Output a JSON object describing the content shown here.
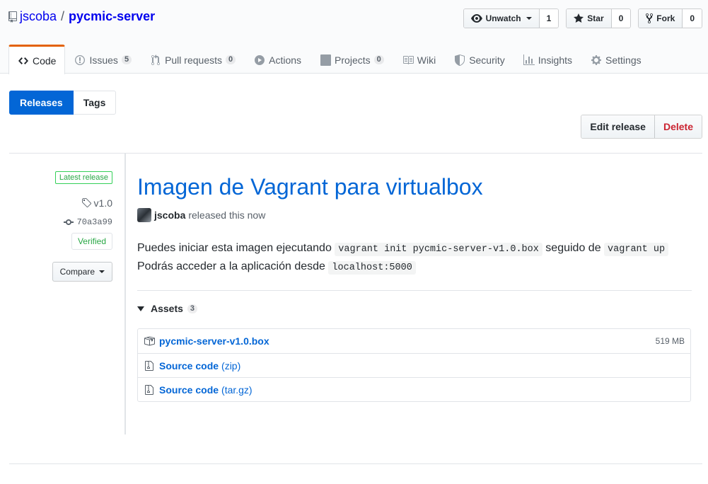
{
  "repo": {
    "owner": "jscoba",
    "separator": "/",
    "name": "pycmic-server"
  },
  "actions": {
    "watch": {
      "label": "Unwatch",
      "count": "1"
    },
    "star": {
      "label": "Star",
      "count": "0"
    },
    "fork": {
      "label": "Fork",
      "count": "0"
    }
  },
  "tabs": [
    {
      "label": "Code",
      "icon": "code-icon",
      "counter": null
    },
    {
      "label": "Issues",
      "icon": "issue-icon",
      "counter": "5"
    },
    {
      "label": "Pull requests",
      "icon": "pull-request-icon",
      "counter": "0"
    },
    {
      "label": "Actions",
      "icon": "play-icon",
      "counter": null
    },
    {
      "label": "Projects",
      "icon": "project-icon",
      "counter": "0"
    },
    {
      "label": "Wiki",
      "icon": "book-icon",
      "counter": null
    },
    {
      "label": "Security",
      "icon": "shield-icon",
      "counter": null
    },
    {
      "label": "Insights",
      "icon": "graph-icon",
      "counter": null
    },
    {
      "label": "Settings",
      "icon": "gear-icon",
      "counter": null
    }
  ],
  "subnav": {
    "releases": "Releases",
    "tags": "Tags"
  },
  "release_actions": {
    "edit": "Edit release",
    "delete": "Delete"
  },
  "meta": {
    "latest_label": "Latest release",
    "tag": "v1.0",
    "commit": "70a3a99",
    "verified": "Verified",
    "compare": "Compare"
  },
  "release": {
    "title": "Imagen de Vagrant para virtualbox",
    "author": "jscoba",
    "released_text": "released this now",
    "body": {
      "line1_prefix": "Puedes iniciar esta imagen ejecutando",
      "line1_code1": "vagrant init pycmic-server-v1.0.box",
      "line1_mid": "seguido de",
      "line1_code2": "vagrant up",
      "line2_prefix": "Podrás acceder a la aplicación desde",
      "line2_code": "localhost:5000"
    }
  },
  "assets": {
    "label": "Assets",
    "count": "3",
    "items": [
      {
        "name": "pycmic-server-v1.0.box",
        "suffix": "",
        "size": "519 MB",
        "icon": "package-icon"
      },
      {
        "name": "Source code",
        "suffix": "(zip)",
        "size": "",
        "icon": "file-zip-icon"
      },
      {
        "name": "Source code",
        "suffix": "(tar.gz)",
        "size": "",
        "icon": "file-zip-icon"
      }
    ]
  },
  "colors": {
    "link": "#0366d6",
    "nav_accent": "#e36209",
    "danger": "#cb2431",
    "success": "#28a745"
  }
}
